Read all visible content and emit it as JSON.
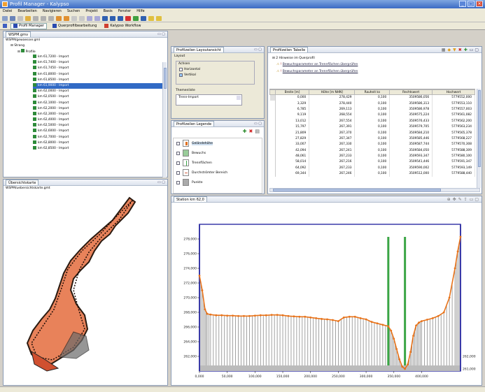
{
  "window": {
    "title": "Profil Manager - Kalypso",
    "buttons": [
      "_",
      "□",
      "×"
    ]
  },
  "menu": [
    "Datei",
    "Bearbeiten",
    "Navigieren",
    "Suchen",
    "Projekt",
    "Basis",
    "Fenster",
    "Hilfe"
  ],
  "perspectives": [
    {
      "label": "Profil Manager",
      "active": true
    },
    {
      "label": "Querprofilbearbeitung",
      "active": false
    },
    {
      "label": "Kalypso Workflow",
      "active": false
    }
  ],
  "tree_panel": {
    "tab": "WSPM.gmv",
    "file": "WSPM/gewaesser.gml",
    "root": "Strang",
    "node": "Profile",
    "items": [
      "km 61,7200 - Import",
      "km 61,7400 - Import",
      "km 61,7450 - Import",
      "km 61,8000 - Import",
      "km 61,8500 - Import",
      "km 61,9000 - Import",
      "km 62,0000 - Import",
      "km 62,0500 - Import",
      "km 62,1000 - Import",
      "km 62,2000 - Import",
      "km 62,3000 - Import",
      "km 62,4000 - Import",
      "km 62,5000 - Import",
      "km 62,6000 - Import",
      "km 62,7000 - Import",
      "km 62,8000 - Import",
      "km 62,8500 - Import"
    ],
    "selected_index": 5
  },
  "map_panel": {
    "tab": "Übersichtskarte",
    "file": "WSPM/uebersichtskarte.gmt"
  },
  "layout_panel": {
    "tab": "Profilzeilen Layoutansicht",
    "group_layout": "Layout",
    "group_ansicht": "Achsen",
    "options": [
      "Horizontal",
      "Vertikal"
    ],
    "label_themen": "Themenliste",
    "select_value": "Trenn-Import"
  },
  "legend_panel": {
    "tab": "Profilzeilen Legende",
    "items": [
      "Geländehöhe",
      "Bewuchs",
      "Trennflächen",
      "Durchströmter Bereich",
      "Punkte"
    ]
  },
  "table_panel": {
    "tab": "Profilzeilen Tabelle",
    "hint_title": "2 Hinweise im Querprofil",
    "hints": [
      "Bewuchsparameter an Trennflächen überprüfen",
      "Bewuchsparameter an Trennflächen überprüfen"
    ],
    "columns": [
      "Breite [m]",
      "Höhe [m NHN]",
      "Rauheit ks",
      "Rechtswert",
      "Hochwert"
    ],
    "rows": [
      [
        "0,000",
        "278,429",
        "0,100",
        "3509586,056",
        "5779552,000"
      ],
      [
        "3,329",
        "278,440",
        "0,100",
        "3509586,313",
        "5779553,110"
      ],
      [
        "6,785",
        "269,113",
        "0,100",
        "3509586,978",
        "5779557,003"
      ],
      [
        "9,119",
        "268,554",
        "0,100",
        "3509575,224",
        "5779561,082"
      ],
      [
        "13,012",
        "267,554",
        "0,100",
        "3509576,433",
        "5779562,200"
      ],
      [
        "15,797",
        "267,391",
        "0,100",
        "3509579,705",
        "5779563,234"
      ],
      [
        "21,809",
        "267,370",
        "0,100",
        "3509584,210",
        "5779565,378"
      ],
      [
        "27,829",
        "267,347",
        "0,100",
        "3509585,446",
        "5779568,227"
      ],
      [
        "33,007",
        "267,330",
        "0,100",
        "3509587,744",
        "5779570,308"
      ],
      [
        "42,094",
        "267,241",
        "0,100",
        "3509584,050",
        "5779588,309"
      ],
      [
        "48,061",
        "267,233",
        "0,100",
        "3509593,347",
        "5779580,100"
      ],
      [
        "58,014",
        "267,216",
        "0,100",
        "3509541,446",
        "5779591,347"
      ],
      [
        "64,092",
        "267,233",
        "0,100",
        "3509590,002",
        "5779593,149"
      ],
      [
        "69,344",
        "267,246",
        "0,100",
        "3509512,000",
        "5779588,440"
      ]
    ]
  },
  "chart_panel": {
    "tab": "Station km 62,0"
  },
  "chart_data": {
    "type": "line",
    "title": "",
    "xlabel": "",
    "ylabel": "",
    "xlim": [
      0,
      470
    ],
    "ylim": [
      260,
      280
    ],
    "x_ticks": [
      "0,000",
      "50,000",
      "100,000",
      "150,000",
      "200,000",
      "250,000",
      "300,000",
      "350,000",
      "400,000"
    ],
    "y_ticks": [
      "262,000",
      "264,000",
      "266,000",
      "268,000",
      "270,000",
      "272,000",
      "274,000",
      "276,000",
      "278,000"
    ],
    "right_ticks": [
      "262,000",
      "261,000"
    ],
    "series": [
      {
        "x": [
          0,
          5,
          10,
          14,
          20,
          30,
          40,
          50,
          60,
          70,
          80,
          90,
          100,
          110,
          120,
          130,
          140,
          150,
          160,
          170,
          180,
          190,
          200,
          210,
          220,
          230,
          240,
          250,
          260,
          270,
          280,
          290,
          300,
          310,
          320,
          330,
          340,
          345,
          350,
          355,
          360,
          365,
          370,
          375,
          380,
          385,
          390,
          395,
          400,
          410,
          420,
          430,
          440,
          450,
          460,
          465,
          470
        ],
        "y": [
          273,
          271,
          268.4,
          267.8,
          267.7,
          267.6,
          267.6,
          267.55,
          267.55,
          267.5,
          267.5,
          267.5,
          267.55,
          267.6,
          267.6,
          267.65,
          267.65,
          267.6,
          267.5,
          267.45,
          267.4,
          267.4,
          267.3,
          267.2,
          267.1,
          267.05,
          266.95,
          266.8,
          267.3,
          267.4,
          267.4,
          267.2,
          267.05,
          266.7,
          266.5,
          266.3,
          266.1,
          265.5,
          264.4,
          263.0,
          261.6,
          260.6,
          260.3,
          260.9,
          262.6,
          264.8,
          266.2,
          266.6,
          266.8,
          267.0,
          267.2,
          267.5,
          268.0,
          270.0,
          274.0,
          276.3,
          278.3
        ]
      }
    ],
    "markers": {
      "trennflaechen_x": [
        340,
        370
      ],
      "bordvoll_x": [
        0,
        470
      ]
    },
    "grid": false,
    "legend": "none",
    "colors": {
      "line": "#e8731a",
      "grid_fill": "#8a8a8a",
      "trenn": "#3aa545",
      "border": "#3a3aa8"
    }
  },
  "status": [
    "",
    "",
    ""
  ]
}
